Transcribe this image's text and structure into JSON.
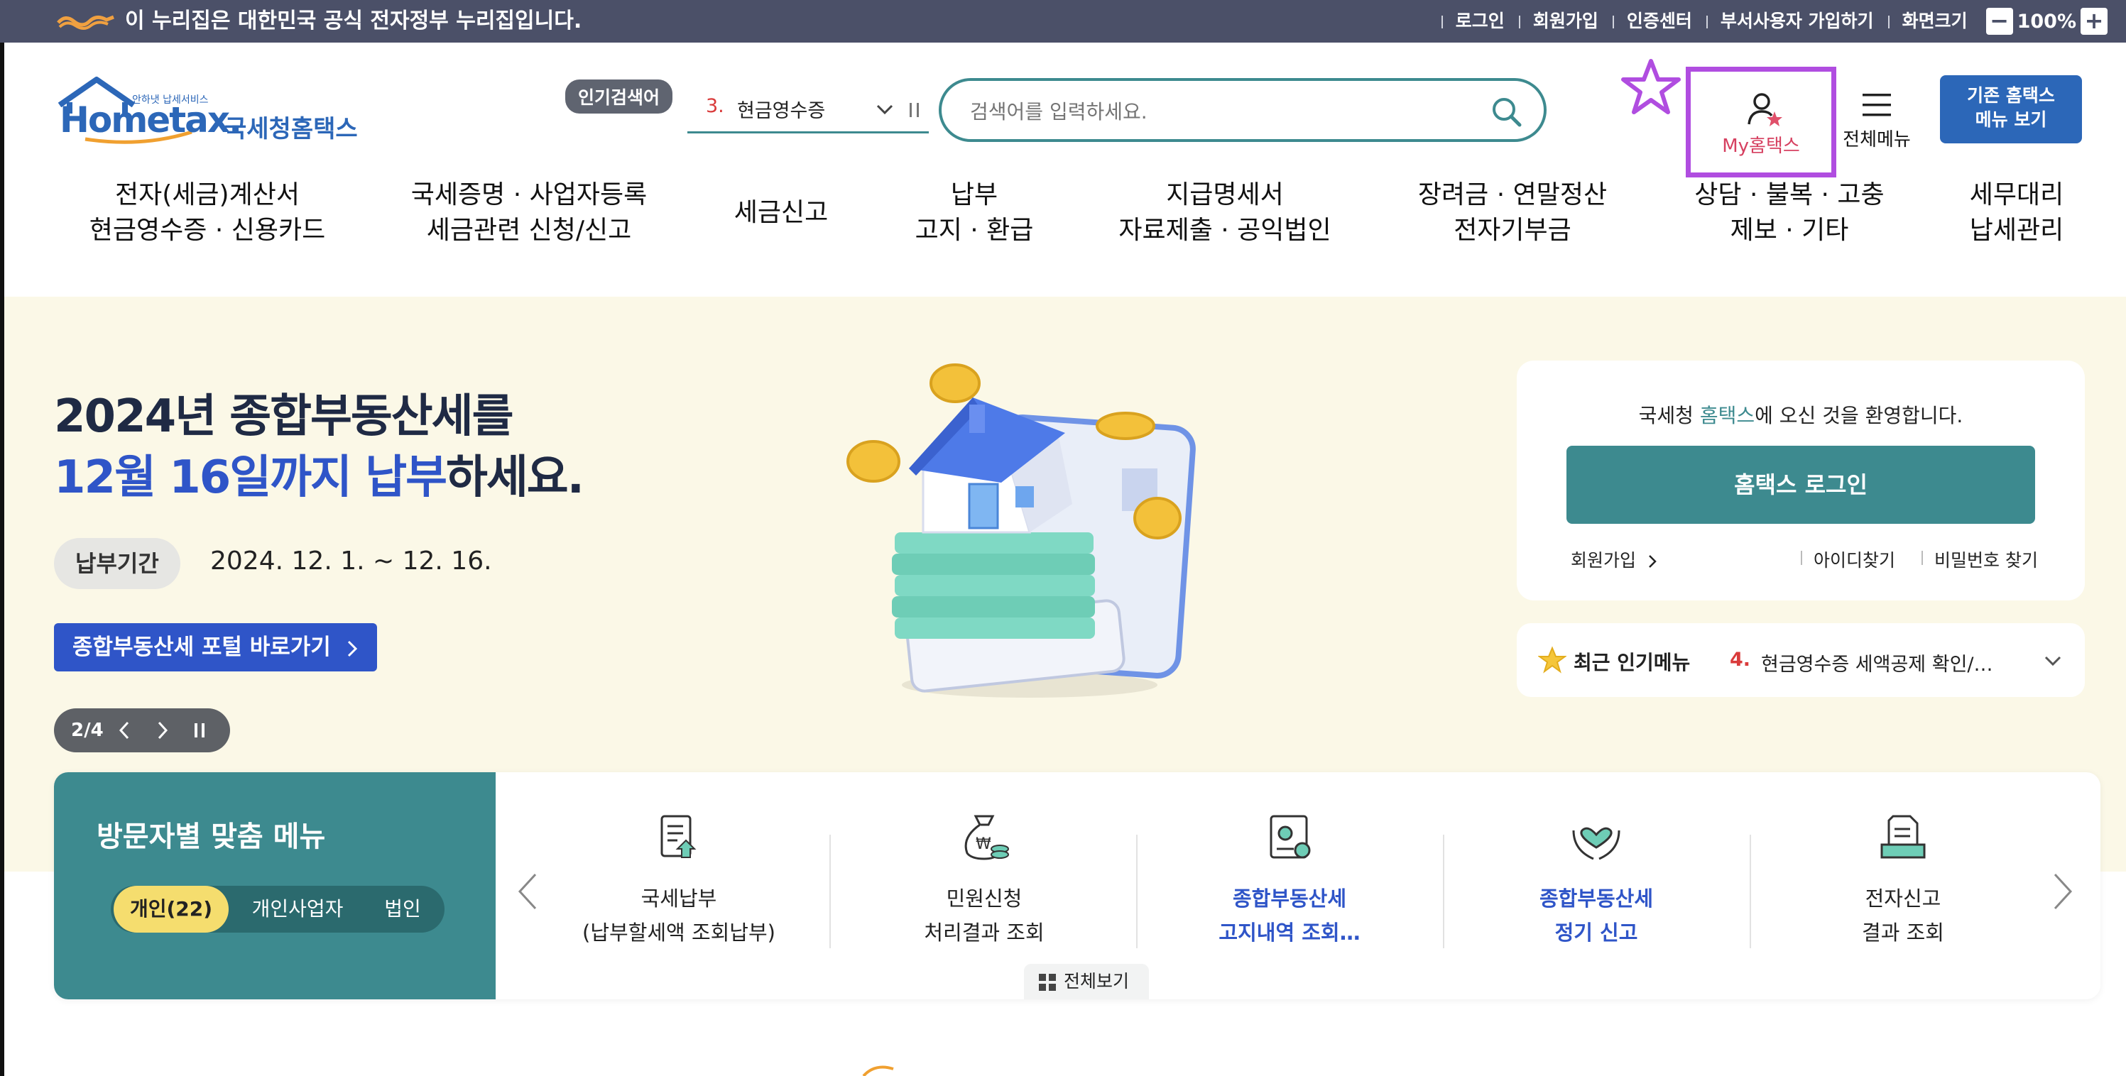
{
  "govbar": {
    "text": "이 누리집은 대한민국 공식 전자정부 누리집입니다.",
    "links": [
      "로그인",
      "회원가입",
      "인증센터",
      "부서사용자 가입하기",
      "화면크기"
    ],
    "zoom": "100%",
    "zoom_minus": "−",
    "zoom_plus": "+"
  },
  "header": {
    "logo_small": "안하냇 납세서비스",
    "logo_main": "Hometax.",
    "logo_sub": "국세청홈택스",
    "popular_tag": "인기검색어",
    "popular_num": "3.",
    "popular_text": "현금영수증",
    "search_placeholder": "검색어를 입력하세요.",
    "my_label": "My홈택스",
    "allmenu_label": "전체메뉴",
    "old_btn_line1": "기존 홈택스",
    "old_btn_line2": "메뉴 보기"
  },
  "nav": [
    {
      "l1": "전자(세금)계산서",
      "l2": "현금영수증 · 신용카드"
    },
    {
      "l1": "국세증명 · 사업자등록",
      "l2": "세금관련 신청/신고"
    },
    {
      "l1": "세금신고",
      "l2": ""
    },
    {
      "l1": "납부",
      "l2": "고지 · 환급"
    },
    {
      "l1": "지급명세서",
      "l2": "자료제출 · 공익법인"
    },
    {
      "l1": "장려금 · 연말정산",
      "l2": "전자기부금"
    },
    {
      "l1": "상담 · 불복 · 고충",
      "l2": "제보 · 기타"
    },
    {
      "l1": "세무대리",
      "l2": "납세관리"
    }
  ],
  "hero": {
    "title_line1": "2024년 종합부동산세를",
    "title_line2_blue1": "12월 16일까지 납부",
    "title_line2_rest": "하세요.",
    "period_label": "납부기간",
    "period_value": "2024. 12. 1. ~ 12. 16.",
    "portal_btn": "종합부동산세 포털 바로가기",
    "slide_counter": "2/4"
  },
  "login_card": {
    "welcome_pre": "국세청 ",
    "welcome_brand": "홈택스",
    "welcome_post": "에 오신 것을 환영합니다.",
    "login_btn": "홈택스 로그인",
    "signup": "회원가입",
    "find_id": "아이디찾기",
    "find_pw": "비밀번호 찾기"
  },
  "recent": {
    "label": "최근 인기메뉴",
    "num": "4.",
    "text": "현금영수증 세액공제 확인/…"
  },
  "visitor": {
    "title": "방문자별 맞춤 메뉴",
    "tabs": [
      "개인(22)",
      "개인사업자",
      "법인"
    ],
    "items": [
      {
        "l1": "국세납부",
        "l2": "(납부할세액 조회납부)",
        "icon": "tax-payment-icon"
      },
      {
        "l1": "민원신청",
        "l2": "처리결과 조회",
        "icon": "money-bag-icon"
      },
      {
        "l1": "종합부동산세",
        "l2": "고지내역 조회…",
        "icon": "certificate-icon"
      },
      {
        "l1": "종합부동산세",
        "l2": "정기 신고",
        "icon": "heart-hands-icon"
      },
      {
        "l1": "전자신고",
        "l2": "결과 조회",
        "icon": "document-tray-icon"
      }
    ],
    "view_all": "전체보기"
  },
  "colors": {
    "govbar": "#4b5068",
    "teal": "#3d8a8f",
    "blue": "#2f55c8",
    "my_border": "#b04de0",
    "hero_bg": "#fbf8e7",
    "tab_active": "#f5dd6e"
  }
}
